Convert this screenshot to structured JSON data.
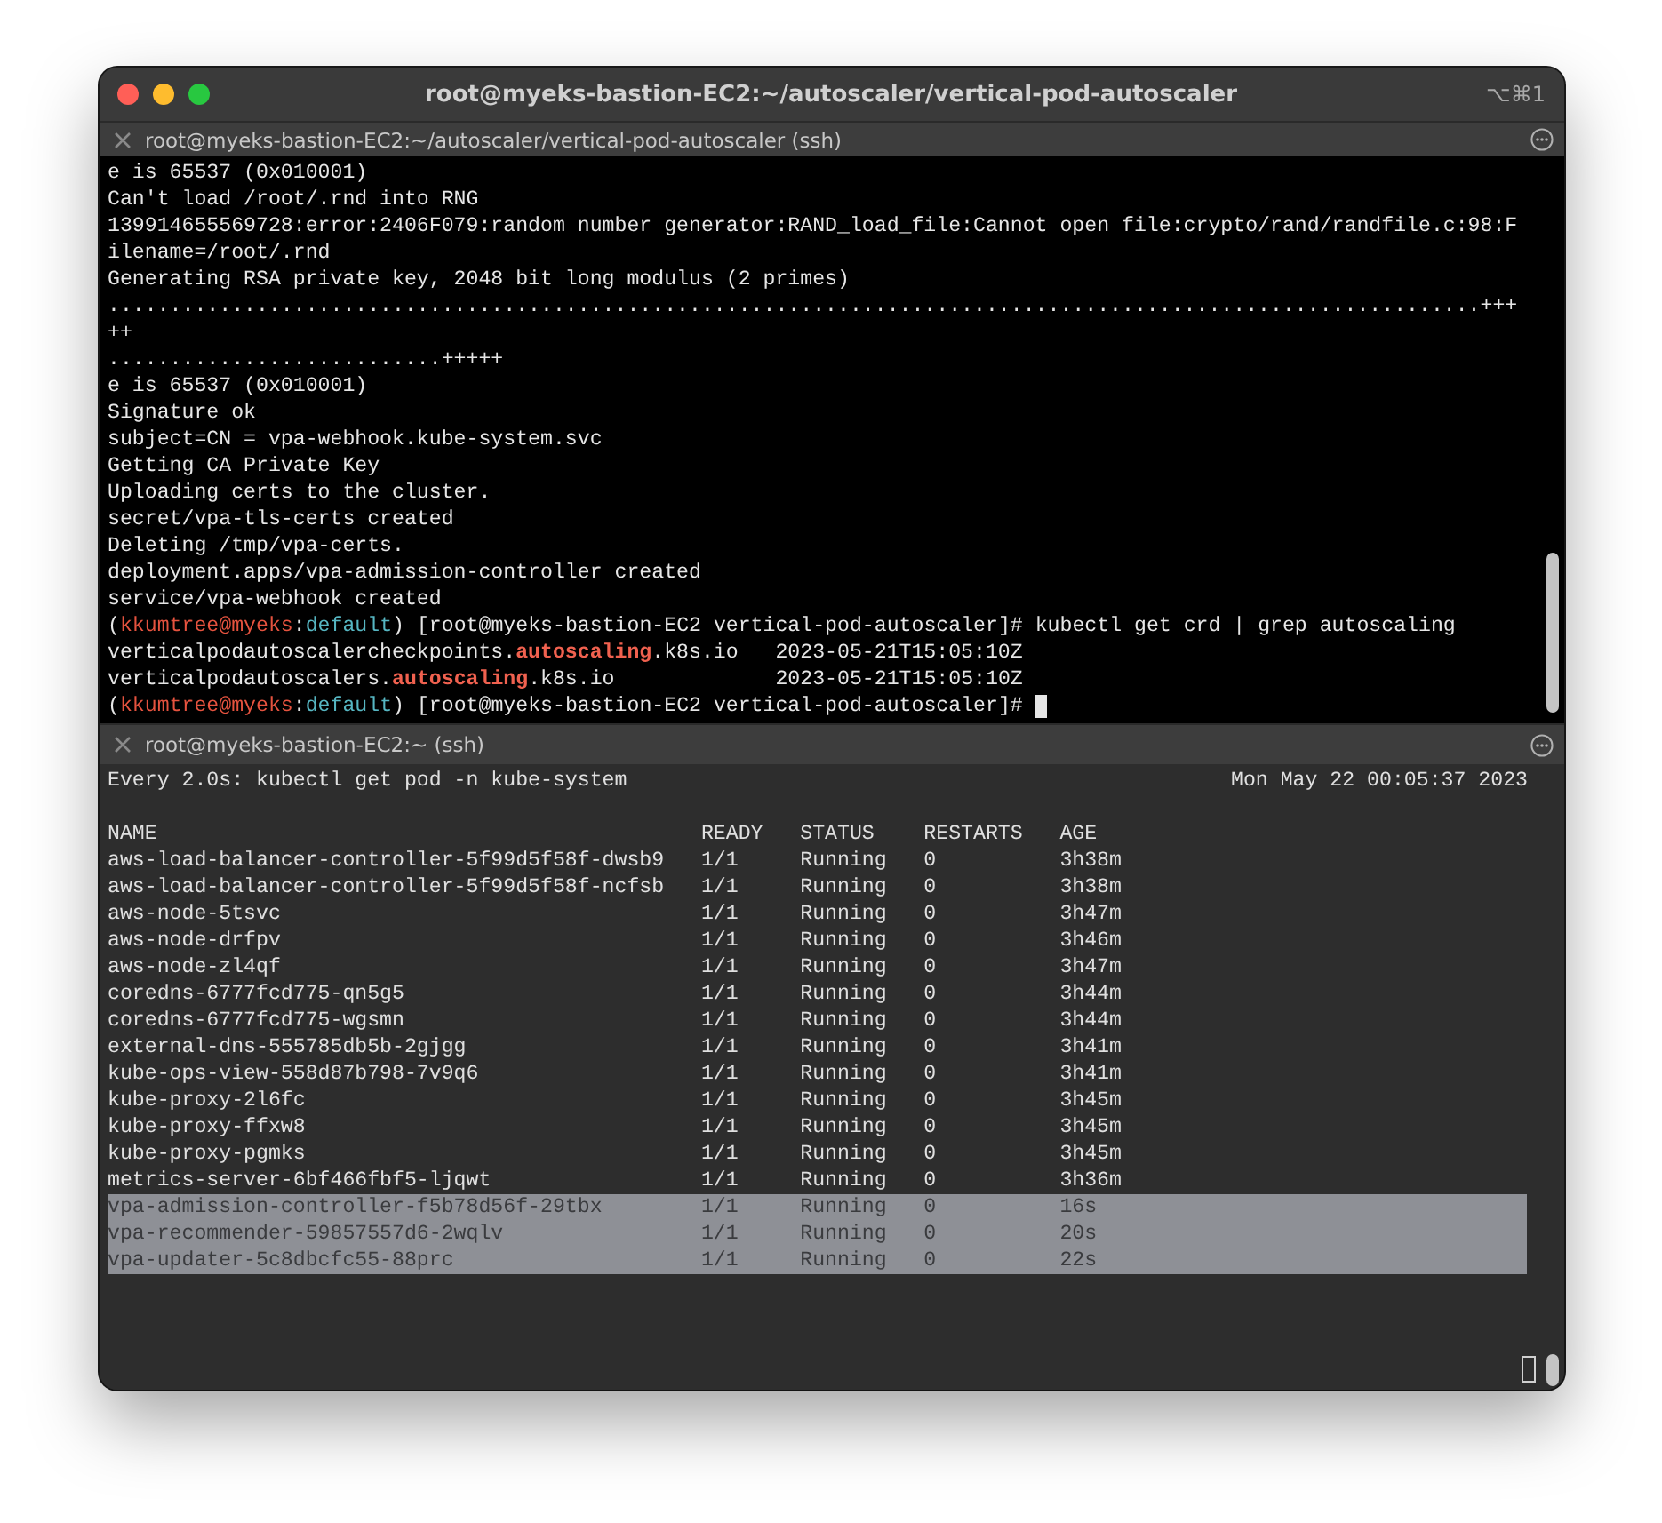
{
  "window": {
    "title": "root@myeks-bastion-EC2:~/autoscaler/vertical-pod-autoscaler",
    "shortcut": "⌥⌘1"
  },
  "top_pane": {
    "tab_title": "root@myeks-bastion-EC2:~/autoscaler/vertical-pod-autoscaler (ssh)",
    "lines": [
      {
        "cursor": false,
        "segments": [
          {
            "text": "e is 65537 (0x010001)",
            "kind": "plain"
          }
        ]
      },
      {
        "cursor": false,
        "segments": [
          {
            "text": "Can't load /root/.rnd into RNG",
            "kind": "plain"
          }
        ]
      },
      {
        "cursor": false,
        "segments": [
          {
            "text": "139914655569728:error:2406F079:random number generator:RAND_load_file:Cannot open file:crypto/rand/randfile.c:98:F",
            "kind": "plain"
          }
        ]
      },
      {
        "cursor": false,
        "segments": [
          {
            "text": "ilename=/root/.rnd",
            "kind": "plain"
          }
        ]
      },
      {
        "cursor": false,
        "segments": [
          {
            "text": "Generating RSA private key, 2048 bit long modulus (2 primes)",
            "kind": "plain"
          }
        ]
      },
      {
        "cursor": false,
        "segments": [
          {
            "text": "...............................................................................................................+++",
            "kind": "plain"
          }
        ]
      },
      {
        "cursor": false,
        "segments": [
          {
            "text": "++",
            "kind": "plain"
          }
        ]
      },
      {
        "cursor": false,
        "segments": [
          {
            "text": "...........................+++++",
            "kind": "plain"
          }
        ]
      },
      {
        "cursor": false,
        "segments": [
          {
            "text": "e is 65537 (0x010001)",
            "kind": "plain"
          }
        ]
      },
      {
        "cursor": false,
        "segments": [
          {
            "text": "Signature ok",
            "kind": "plain"
          }
        ]
      },
      {
        "cursor": false,
        "segments": [
          {
            "text": "subject=CN = vpa-webhook.kube-system.svc",
            "kind": "plain"
          }
        ]
      },
      {
        "cursor": false,
        "segments": [
          {
            "text": "Getting CA Private Key",
            "kind": "plain"
          }
        ]
      },
      {
        "cursor": false,
        "segments": [
          {
            "text": "Uploading certs to the cluster.",
            "kind": "plain"
          }
        ]
      },
      {
        "cursor": false,
        "segments": [
          {
            "text": "secret/vpa-tls-certs created",
            "kind": "plain"
          }
        ]
      },
      {
        "cursor": false,
        "segments": [
          {
            "text": "Deleting /tmp/vpa-certs.",
            "kind": "plain"
          }
        ]
      },
      {
        "cursor": false,
        "segments": [
          {
            "text": "deployment.apps/vpa-admission-controller created",
            "kind": "plain"
          }
        ]
      },
      {
        "cursor": false,
        "segments": [
          {
            "text": "service/vpa-webhook created",
            "kind": "plain"
          }
        ]
      },
      {
        "cursor": false,
        "segments": [
          {
            "text": "(",
            "kind": "plain"
          },
          {
            "text": "kkumtree@myeks",
            "kind": "user"
          },
          {
            "text": ":",
            "kind": "plain"
          },
          {
            "text": "default",
            "kind": "context"
          },
          {
            "text": ") [root@myeks-bastion-EC2 vertical-pod-autoscaler]# kubectl get crd | grep autoscaling",
            "kind": "plain"
          }
        ]
      },
      {
        "cursor": false,
        "segments": [
          {
            "text": "verticalpodautoscalercheckpoints.",
            "kind": "plain"
          },
          {
            "text": "autoscaling",
            "kind": "match"
          },
          {
            "text": ".k8s.io   2023-05-21T15:05:10Z",
            "kind": "plain"
          }
        ]
      },
      {
        "cursor": false,
        "segments": [
          {
            "text": "verticalpodautoscalers.",
            "kind": "plain"
          },
          {
            "text": "autoscaling",
            "kind": "match"
          },
          {
            "text": ".k8s.io             2023-05-21T15:05:10Z",
            "kind": "plain"
          }
        ]
      },
      {
        "cursor": true,
        "segments": [
          {
            "text": "(",
            "kind": "plain"
          },
          {
            "text": "kkumtree@myeks",
            "kind": "user"
          },
          {
            "text": ":",
            "kind": "plain"
          },
          {
            "text": "default",
            "kind": "context"
          },
          {
            "text": ") [root@myeks-bastion-EC2 vertical-pod-autoscaler]#",
            "kind": "plain"
          }
        ]
      }
    ]
  },
  "bottom_pane": {
    "tab_title": "root@myeks-bastion-EC2:~ (ssh)",
    "command": "Every 2.0s: kubectl get pod -n kube-system",
    "time": "Mon May 22 00:05:37 2023",
    "columns": [
      "NAME",
      "READY",
      "STATUS",
      "RESTARTS",
      "AGE"
    ],
    "rows": [
      {
        "cells": [
          "aws-load-balancer-controller-5f99d5f58f-dwsb9",
          "1/1",
          "Running",
          "0",
          "3h38m"
        ],
        "selected": false
      },
      {
        "cells": [
          "aws-load-balancer-controller-5f99d5f58f-ncfsb",
          "1/1",
          "Running",
          "0",
          "3h38m"
        ],
        "selected": false
      },
      {
        "cells": [
          "aws-node-5tsvc",
          "1/1",
          "Running",
          "0",
          "3h47m"
        ],
        "selected": false
      },
      {
        "cells": [
          "aws-node-drfpv",
          "1/1",
          "Running",
          "0",
          "3h46m"
        ],
        "selected": false
      },
      {
        "cells": [
          "aws-node-zl4qf",
          "1/1",
          "Running",
          "0",
          "3h47m"
        ],
        "selected": false
      },
      {
        "cells": [
          "coredns-6777fcd775-qn5g5",
          "1/1",
          "Running",
          "0",
          "3h44m"
        ],
        "selected": false
      },
      {
        "cells": [
          "coredns-6777fcd775-wgsmn",
          "1/1",
          "Running",
          "0",
          "3h44m"
        ],
        "selected": false
      },
      {
        "cells": [
          "external-dns-555785db5b-2gjgg",
          "1/1",
          "Running",
          "0",
          "3h41m"
        ],
        "selected": false
      },
      {
        "cells": [
          "kube-ops-view-558d87b798-7v9q6",
          "1/1",
          "Running",
          "0",
          "3h41m"
        ],
        "selected": false
      },
      {
        "cells": [
          "kube-proxy-2l6fc",
          "1/1",
          "Running",
          "0",
          "3h45m"
        ],
        "selected": false
      },
      {
        "cells": [
          "kube-proxy-ffxw8",
          "1/1",
          "Running",
          "0",
          "3h45m"
        ],
        "selected": false
      },
      {
        "cells": [
          "kube-proxy-pgmks",
          "1/1",
          "Running",
          "0",
          "3h45m"
        ],
        "selected": false
      },
      {
        "cells": [
          "metrics-server-6bf466fbf5-ljqwt",
          "1/1",
          "Running",
          "0",
          "3h36m"
        ],
        "selected": false
      },
      {
        "cells": [
          "vpa-admission-controller-f5b78d56f-29tbx",
          "1/1",
          "Running",
          "0",
          "16s"
        ],
        "selected": true
      },
      {
        "cells": [
          "vpa-recommender-59857557d6-2wqlv",
          "1/1",
          "Running",
          "0",
          "20s"
        ],
        "selected": true
      },
      {
        "cells": [
          "vpa-updater-5c8dbcfc55-88prc",
          "1/1",
          "Running",
          "0",
          "22s"
        ],
        "selected": true
      }
    ]
  }
}
